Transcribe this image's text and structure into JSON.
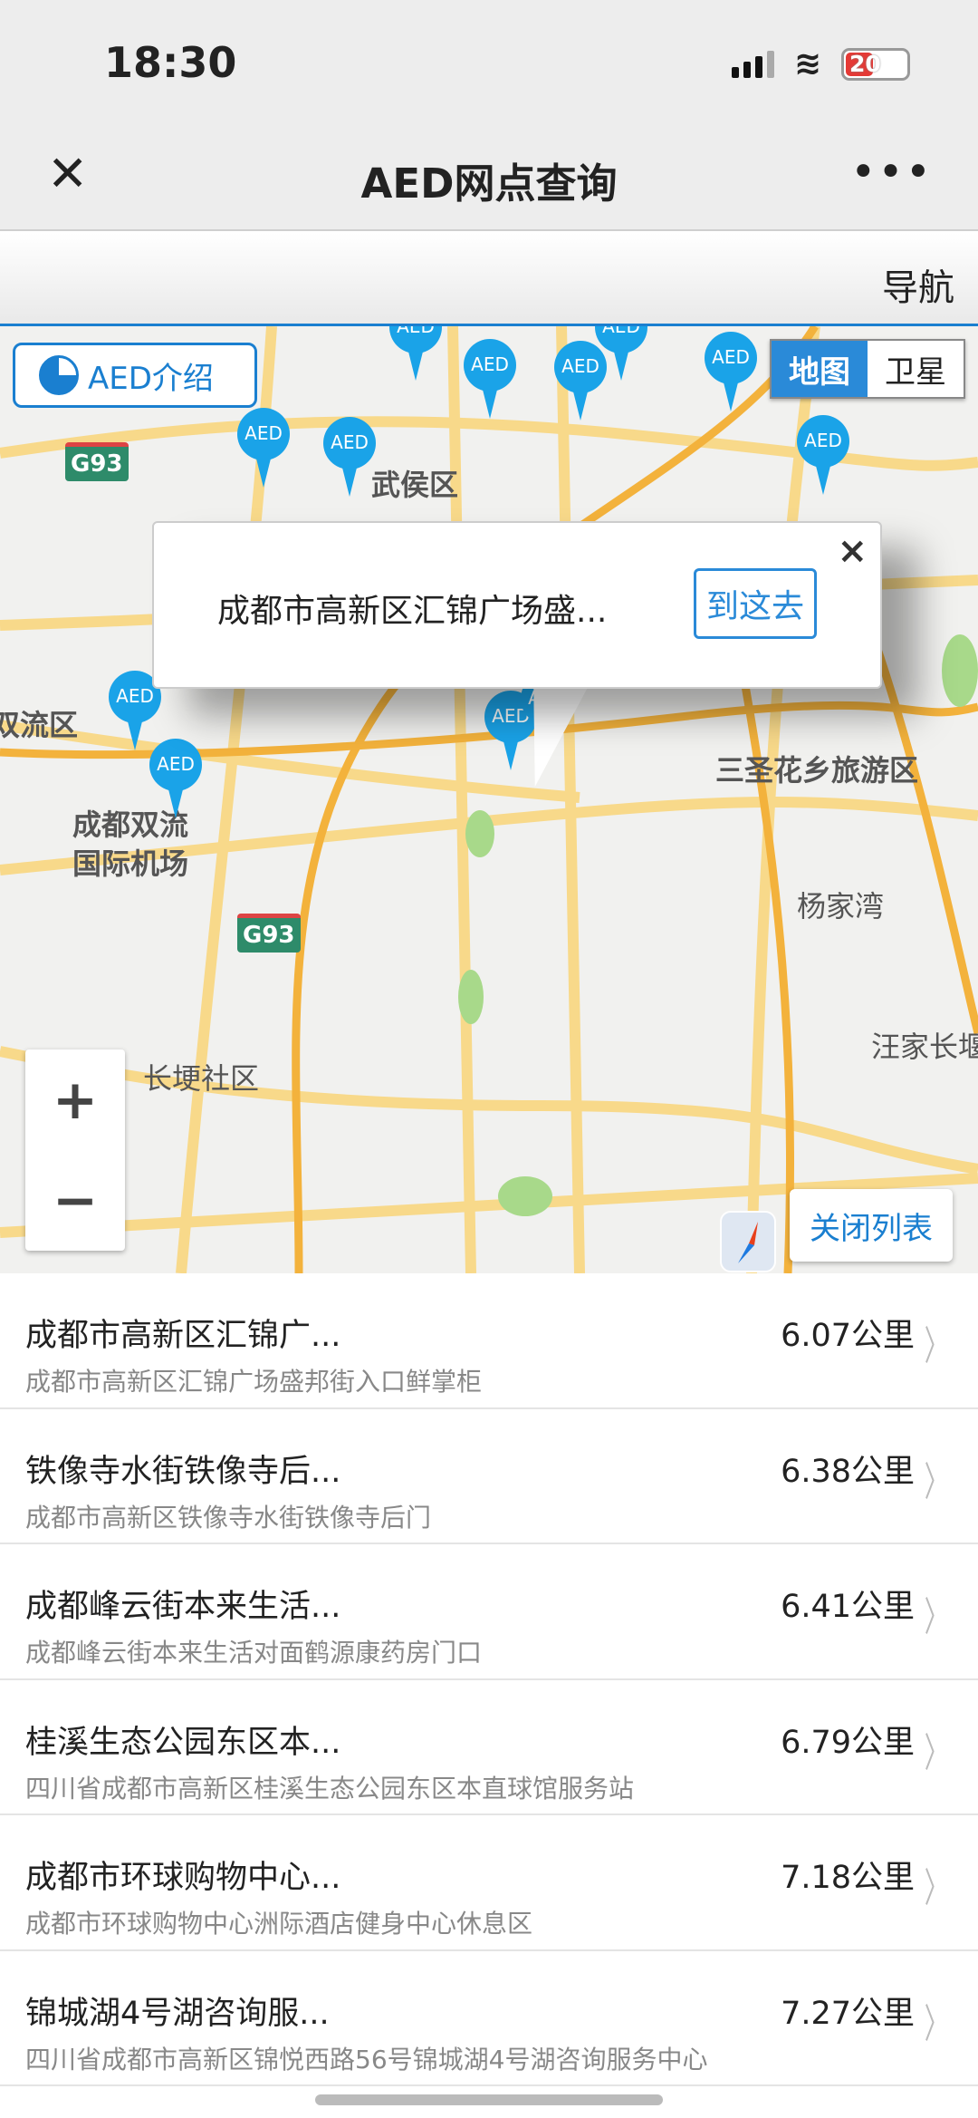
{
  "status": {
    "time": "18:30",
    "battery": "20"
  },
  "header": {
    "close_icon": "close-icon",
    "title": "AED网点查询",
    "more_icon": "more-icon"
  },
  "navbar": {
    "nav_label": "导航"
  },
  "map": {
    "intro_button": "AED介绍",
    "map_types": [
      "地图",
      "卫星"
    ],
    "active_type": "地图",
    "pin_label": "AED",
    "labels": [
      "武侯区",
      "双流区",
      "成都双流",
      "国际机场",
      "三圣花乡旅游区",
      "杨家湾",
      "汪家长堰",
      "长埂社区",
      "G93",
      "G93"
    ],
    "popup": {
      "text": "成都市高新区汇锦广场盛...",
      "go_button": "到这去",
      "close": "×"
    },
    "zoom_in": "+",
    "zoom_out": "−",
    "close_list_button": "关闭列表",
    "accent": "#1a7fd0",
    "pin_color": "#1aa3e8"
  },
  "list": [
    {
      "name": "成都市高新区汇锦广...",
      "address": "成都市高新区汇锦广场盛邦街入口鲜掌柜",
      "distance": "6.07公里"
    },
    {
      "name": "铁像寺水街铁像寺后...",
      "address": "成都市高新区铁像寺水街铁像寺后门",
      "distance": "6.38公里"
    },
    {
      "name": "成都峰云街本来生活...",
      "address": "成都峰云街本来生活对面鹤源康药房门口",
      "distance": "6.41公里"
    },
    {
      "name": "桂溪生态公园东区本...",
      "address": "四川省成都市高新区桂溪生态公园东区本直球馆服务站",
      "distance": "6.79公里"
    },
    {
      "name": "成都市环球购物中心...",
      "address": "成都市环球购物中心洲际酒店健身中心休息区",
      "distance": "7.18公里"
    },
    {
      "name": "锦城湖4号湖咨询服...",
      "address": "四川省成都市高新区锦悦西路56号锦城湖4号湖咨询服务中心",
      "distance": "7.27公里"
    }
  ]
}
